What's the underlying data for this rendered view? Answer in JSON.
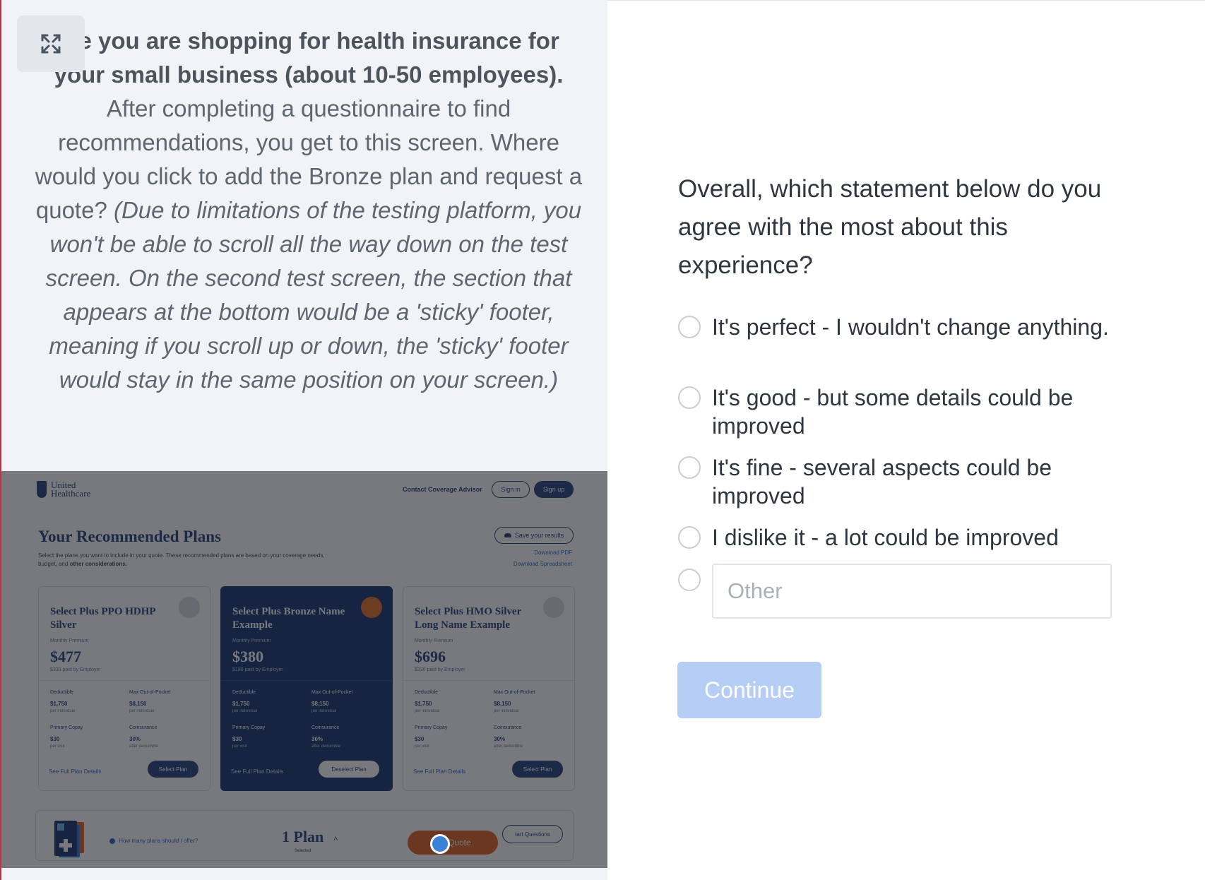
{
  "task": {
    "bold_text": "ine you are shopping for health insurance for your small business (about 10-50 employees).",
    "normal_text": "After completing a questionnaire to find recommendations, you get to this screen. Where would you click to add the Bronze plan and request a quote?",
    "italic_text": "(Due to limitations of the testing platform, you won't be able to scroll all the way down on the test screen. On the second test screen, the section that appears at the bottom would be a 'sticky' footer, meaning if you scroll up or down, the 'sticky' footer would stay in the same position on your screen.)"
  },
  "preview": {
    "logo_line1": "United",
    "logo_line2": "Healthcare",
    "contact": "Contact Coverage Advisor",
    "sign_in": "Sign in",
    "sign_up": "Sign up",
    "title": "Your Recommended Plans",
    "description_1": "Select the plans you want to include in your quote. These recommended plans are based on your coverage needs, budget, and",
    "description_bold": "other considerations.",
    "save_results": "Save your results",
    "download_pdf": "Download PDF",
    "download_sheet": "Download Spreadsheet",
    "plans": [
      {
        "name": "Select Plus PPO HDHP Silver",
        "premium_label": "Monthly Premium",
        "price": "$477",
        "employer": "$330 paid by Employer",
        "deductible_label": "Deductible",
        "deductible": "$1,750",
        "deductible_note": "per individual",
        "oop_label": "Max Out-of-Pocket",
        "oop": "$8,150",
        "oop_note": "per individual",
        "copay_label": "Primary Copay",
        "copay": "$30",
        "copay_note": "per visit",
        "coins_label": "Coinsurance",
        "coins": "30%",
        "coins_note": "after deductible",
        "details": "See Full Plan Details",
        "button": "Select Plan"
      },
      {
        "name": "Select Plus Bronze Name Example",
        "premium_label": "Monthly Premium",
        "price": "$380",
        "employer": "$190 paid by Employer",
        "deductible_label": "Deductible",
        "deductible": "$1,750",
        "deductible_note": "per individual",
        "oop_label": "Max Out-of-Pocket",
        "oop": "$8,150",
        "oop_note": "per individual",
        "copay_label": "Primary Copay",
        "copay": "$30",
        "copay_note": "per visit",
        "coins_label": "Coinsurance",
        "coins": "30%",
        "coins_note": "after deductible",
        "details": "See Full Plan Details",
        "button": "Deselect Plan"
      },
      {
        "name": "Select Plus HMO Silver Long Name Example",
        "premium_label": "Monthly Premium",
        "price": "$696",
        "employer": "$330 paid by Employer",
        "deductible_label": "Deductible",
        "deductible": "$1,750",
        "deductible_note": "per individual",
        "oop_label": "Max Out-of-Pocket",
        "oop": "$8,150",
        "oop_note": "per individual",
        "copay_label": "Primary Copay",
        "copay": "$30",
        "copay_note": "per visit",
        "coins_label": "Coinsurance",
        "coins": "30%",
        "coins_note": "after deductible",
        "details": "See Full Plan Details",
        "button": "Select Plan"
      }
    ],
    "footer": {
      "how_many": "How many plans should I offer?",
      "count": "1 Plan",
      "count_sub": "Selected",
      "quote_button": "Re    Quote",
      "start_questions": "tart Questions"
    }
  },
  "question": {
    "text": "Overall, which statement below do you agree with the most about this experience?",
    "options": [
      "It's perfect - I wouldn't change anything.",
      "It's good - but some details could be improved",
      "It's fine - several aspects could be improved",
      "I dislike it - a lot could be improved"
    ],
    "other_placeholder": "Other",
    "continue_label": "Continue"
  },
  "colors": {
    "accent_disabled": "#b6cef6",
    "brand_navy": "#1f3a78",
    "quote_orange": "#e05a1b",
    "click_marker": "#3b82d6"
  },
  "icons": {
    "expand": "expand-arrows-icon",
    "info": "info-circle-icon",
    "chevron": "chevron-up-icon",
    "cloud": "cloud-save-icon"
  }
}
